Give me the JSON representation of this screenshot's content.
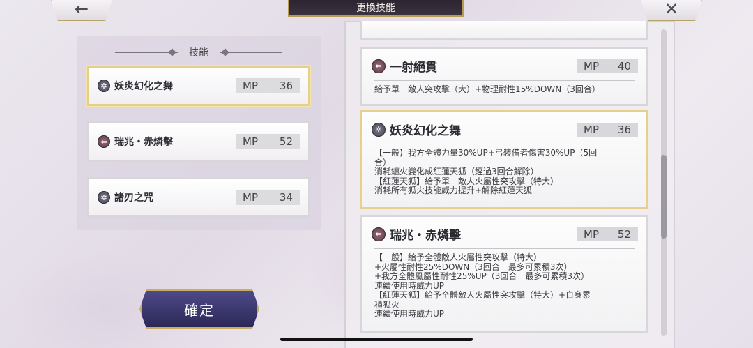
{
  "header": {
    "title": "更換技能",
    "back_icon": "←",
    "close_icon": "✕"
  },
  "left_panel": {
    "title": "技能",
    "slots": [
      {
        "name": "妖炎幻化之舞",
        "mp_label": "MP",
        "mp": "36",
        "icon": "✲"
      },
      {
        "name": "瑞兆・赤燐擊",
        "mp_label": "MP",
        "mp": "52",
        "icon": "⇐"
      },
      {
        "name": "諸刃之咒",
        "mp_label": "MP",
        "mp": "34",
        "icon": "✲"
      }
    ]
  },
  "confirm_label": "確定",
  "skill_list": [
    {
      "name": "一射絕貫",
      "mp_label": "MP",
      "mp": "40",
      "icon": "⇐",
      "desc": "給予單一敵人突攻擊（大）+物理耐性15%DOWN（3回合）"
    },
    {
      "name": "妖炎幻化之舞",
      "mp_label": "MP",
      "mp": "36",
      "icon": "✲",
      "desc": "【一般】我方全體力量30%UP+弓裝備者傷害30%UP（5回\n合）\n消耗纏火變化成紅蓮天狐（經過3回合解除）\n【紅蓮天狐】給予單一敵人火屬性突攻擊（特大）\n消耗所有狐火技能威力提升+解除紅蓮天狐"
    },
    {
      "name": "瑞兆・赤燐擊",
      "mp_label": "MP",
      "mp": "52",
      "icon": "⇐",
      "desc": "【一般】給予全體敵人火屬性突攻擊（特大）\n+火屬性耐性25%DOWN（3回合　最多可累積3次）\n+我方全體風屬性耐性25%UP（3回合　最多可累積3次）\n連續使用時威力UP\n【紅蓮天狐】給予全體敵人火屬性突攻擊（特大）+自身累\n積狐火\n連續使用時威力UP"
    }
  ]
}
